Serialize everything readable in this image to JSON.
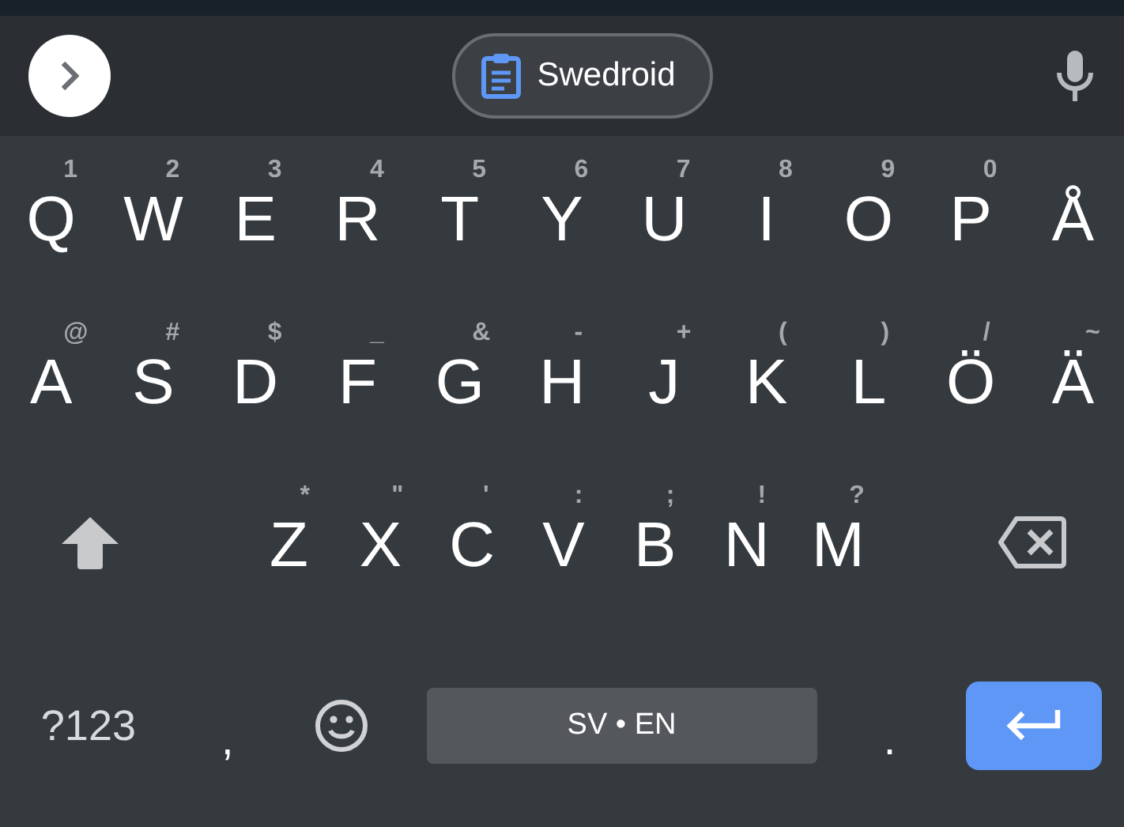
{
  "toolbar": {
    "clipboard_chip": {
      "label": "Swedroid"
    }
  },
  "rows": [
    [
      {
        "kind": "letter",
        "label": "Q",
        "hint": "1"
      },
      {
        "kind": "letter",
        "label": "W",
        "hint": "2"
      },
      {
        "kind": "letter",
        "label": "E",
        "hint": "3"
      },
      {
        "kind": "letter",
        "label": "R",
        "hint": "4"
      },
      {
        "kind": "letter",
        "label": "T",
        "hint": "5"
      },
      {
        "kind": "letter",
        "label": "Y",
        "hint": "6"
      },
      {
        "kind": "letter",
        "label": "U",
        "hint": "7"
      },
      {
        "kind": "letter",
        "label": "I",
        "hint": "8"
      },
      {
        "kind": "letter",
        "label": "O",
        "hint": "9"
      },
      {
        "kind": "letter",
        "label": "P",
        "hint": "0"
      },
      {
        "kind": "letter",
        "label": "Å"
      }
    ],
    [
      {
        "kind": "letter",
        "label": "A",
        "hint": "@"
      },
      {
        "kind": "letter",
        "label": "S",
        "hint": "#"
      },
      {
        "kind": "letter",
        "label": "D",
        "hint": "$"
      },
      {
        "kind": "letter",
        "label": "F",
        "hint": "_"
      },
      {
        "kind": "letter",
        "label": "G",
        "hint": "&"
      },
      {
        "kind": "letter",
        "label": "H",
        "hint": "-"
      },
      {
        "kind": "letter",
        "label": "J",
        "hint": "+"
      },
      {
        "kind": "letter",
        "label": "K",
        "hint": "("
      },
      {
        "kind": "letter",
        "label": "L",
        "hint": ")"
      },
      {
        "kind": "letter",
        "label": "Ö",
        "hint": "/"
      },
      {
        "kind": "letter",
        "label": "Ä",
        "hint": "~"
      }
    ],
    [
      {
        "kind": "shift"
      },
      {
        "kind": "letter",
        "label": "Z",
        "hint": "*"
      },
      {
        "kind": "letter",
        "label": "X",
        "hint": "\""
      },
      {
        "kind": "letter",
        "label": "C",
        "hint": "'"
      },
      {
        "kind": "letter",
        "label": "V",
        "hint": ":"
      },
      {
        "kind": "letter",
        "label": "B",
        "hint": ";"
      },
      {
        "kind": "letter",
        "label": "N",
        "hint": "!"
      },
      {
        "kind": "letter",
        "label": "M",
        "hint": "?"
      },
      {
        "kind": "backspace"
      }
    ],
    [
      {
        "kind": "symbols",
        "label": "?123"
      },
      {
        "kind": "punct",
        "label": ","
      },
      {
        "kind": "emoji"
      },
      {
        "kind": "space",
        "label": "SV • EN"
      },
      {
        "kind": "punct",
        "label": "."
      },
      {
        "kind": "enter"
      }
    ]
  ]
}
